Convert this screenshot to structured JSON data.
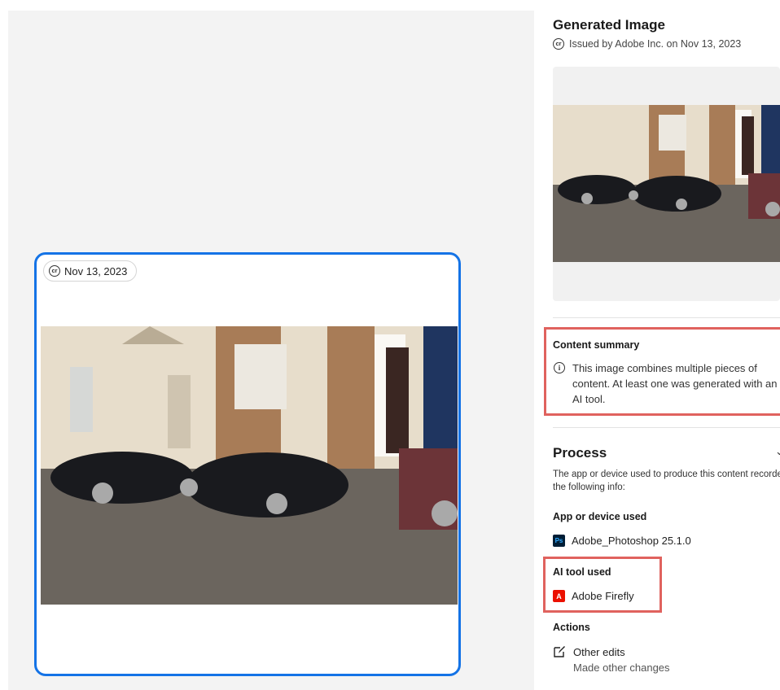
{
  "left_card": {
    "badge_date": "Nov 13, 2023",
    "badge_icon": "content-credentials-icon"
  },
  "panel": {
    "title": "Generated Image",
    "issued_icon": "content-credentials-icon",
    "issued_text": "Issued by Adobe Inc. on Nov 13, 2023"
  },
  "content_summary": {
    "title": "Content summary",
    "icon": "info-icon",
    "text": "This image combines multiple pieces of content. At least one was generated with an AI tool."
  },
  "process": {
    "title": "Process",
    "chevron_icon": "chevron-down-icon",
    "description": "The app or device used to produce this content recorded the following info:",
    "app_label": "App or device used",
    "app_icon_text": "Ps",
    "app_name": "Adobe_Photoshop 25.1.0",
    "ai_label": "AI tool used",
    "ai_icon_text": "A",
    "ai_name": "Adobe Firefly",
    "actions_label": "Actions",
    "action_name": "Other edits",
    "action_desc": "Made other changes"
  },
  "colors": {
    "card_border": "#1473e6",
    "highlight_border": "#e0625e",
    "photoshop_bg": "#001e36",
    "photoshop_text": "#31a8ff",
    "firefly_bg": "#eb1000"
  }
}
